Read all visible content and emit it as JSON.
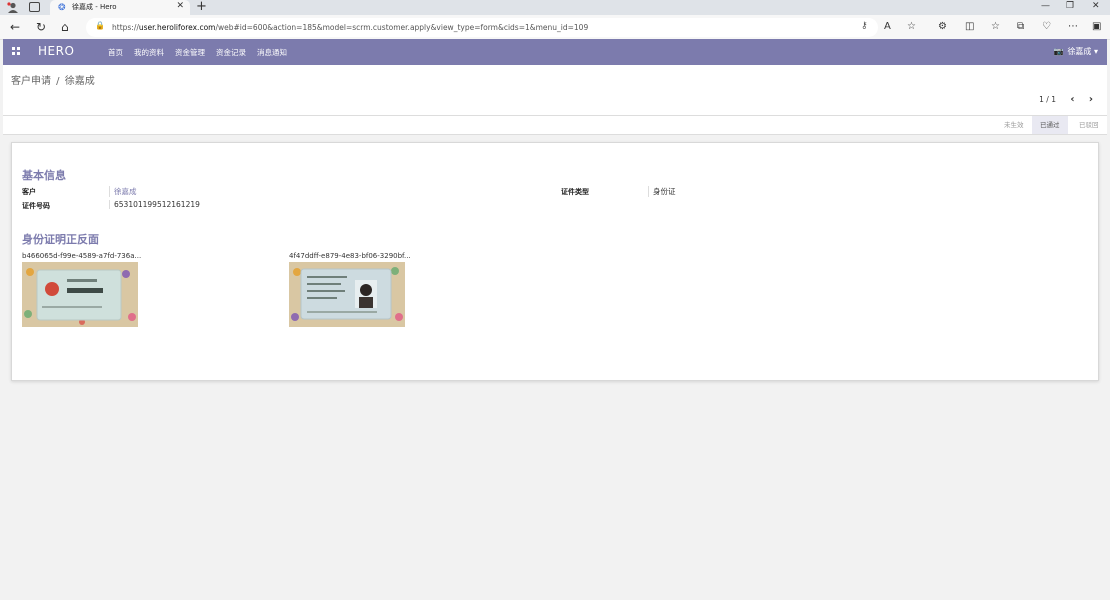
{
  "browser": {
    "tab_title": "徐嘉成 - Hero",
    "url_prefix": "https://",
    "url_host": "user.heroliforex.com",
    "url_rest": "/web#id=600&action=185&model=scrm.customer.apply&view_type=form&cids=1&menu_id=109"
  },
  "navbar": {
    "brand": "HERO",
    "menu": [
      "首页",
      "我的资料",
      "资金管理",
      "资金记录",
      "消息通知"
    ],
    "user_name": "徐嘉成",
    "bg_color": "#7c7bad"
  },
  "breadcrumb": {
    "parent": "客户申请",
    "current": "徐嘉成"
  },
  "pager": {
    "value": "1 / 1"
  },
  "status": {
    "stages": [
      "未生效",
      "已通过",
      "已驳回"
    ],
    "active": "已通过"
  },
  "form": {
    "section_basic": "基本信息",
    "customer_label": "客户",
    "customer_value": "徐嘉成",
    "id_type_label": "证件类型",
    "id_type_value": "身份证",
    "id_number_label": "证件号码",
    "id_number_value": "653101199512161219",
    "section_id": "身份证明正反面",
    "files": [
      {
        "name": "b466065d-f99e-4589-a7fd-736a..."
      },
      {
        "name": "4f47ddff-e879-4e83-bf06-3290bf..."
      }
    ]
  }
}
